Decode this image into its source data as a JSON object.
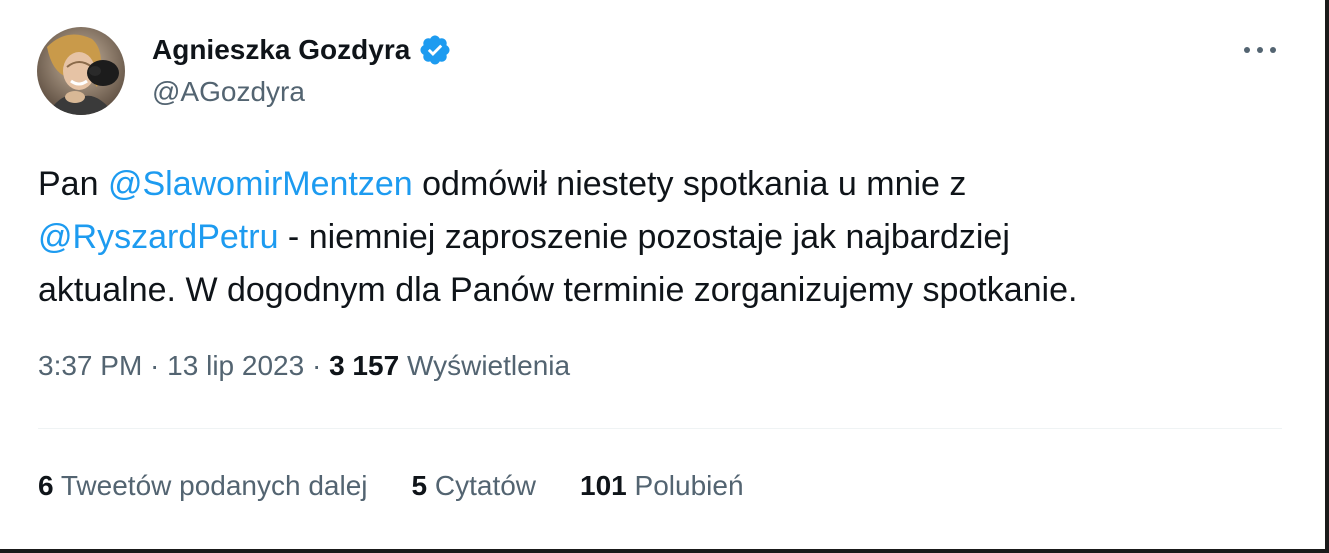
{
  "author": {
    "name": "Agnieszka Gozdyra",
    "handle": "@AGozdyra",
    "verified": true
  },
  "tweet": {
    "line1": {
      "prefix": "Pan ",
      "mention": "@SlawomirMentzen",
      "suffix": " odmówił niestety spotkania u mnie z"
    },
    "line2": {
      "mention": "@RyszardPetru",
      "suffix": " - niemniej zaproszenie pozostaje jak najbardziej"
    },
    "line3": "aktualne. W dogodnym dla Panów terminie zorganizujemy spotkanie."
  },
  "meta": {
    "time": "3:37 PM",
    "separator": " · ",
    "date": "13 lip 2023",
    "views_count": "3 157",
    "views_label": "Wyświetlenia"
  },
  "stats": {
    "retweets_count": "6",
    "retweets_label": "Tweetów podanych dalej",
    "quotes_count": "5",
    "quotes_label": "Cytatów",
    "likes_count": "101",
    "likes_label": "Polubień"
  },
  "colors": {
    "accent": "#1d9bf0",
    "text_primary": "#0f1419",
    "text_secondary": "#536471",
    "divider": "#eff3f4"
  },
  "icons": {
    "verified": "verified-badge-icon",
    "more": "more-options-icon"
  }
}
